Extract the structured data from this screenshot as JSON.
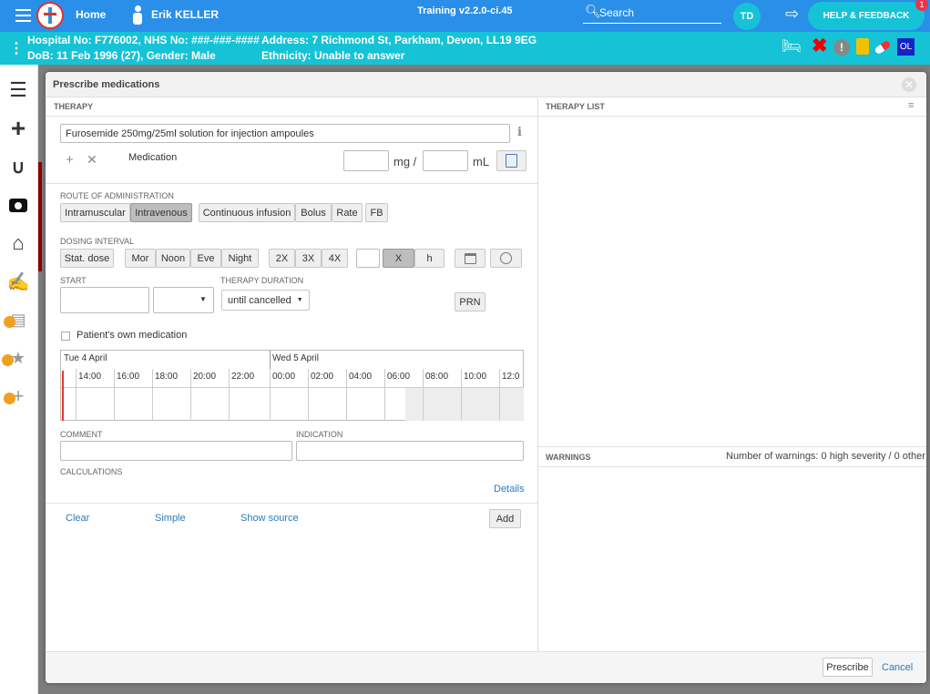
{
  "topbar": {
    "home": "Home",
    "user": "Erik KELLER",
    "version": "Training v2.2.0-ci.45",
    "search": "Search",
    "initials": "TD",
    "help": "HELP & FEEDBACK",
    "help_badge": "1"
  },
  "patient": {
    "line1a": "Hospital No: F776002, NHS No: ###-###-####",
    "line1b": "Address: 7 Richmond St, Parkham, Devon, LL19 9EG",
    "line2a": "DoB: 11 Feb 1996 (27), Gender: Male",
    "line2b": "Ethnicity: Unable to answer",
    "ol": "OL"
  },
  "modal": {
    "title": "Prescribe medications"
  },
  "therapy": {
    "header": "THERAPY",
    "drug": "Furosemide 250mg/25ml solution for injection ampoules",
    "medication_label": "Medication",
    "unit1": "mg /",
    "unit2": "mL"
  },
  "route": {
    "label": "ROUTE OF ADMINISTRATION",
    "buttons": [
      "Intramuscular",
      "Intravenous"
    ],
    "buttons2": [
      "Continuous infusion",
      "Bolus",
      "Rate"
    ],
    "fb": "FB"
  },
  "dosing": {
    "label": "DOSING INTERVAL",
    "stat": "Stat. dose",
    "times": [
      "Mor",
      "Noon",
      "Eve",
      "Night"
    ],
    "freq": [
      "2X",
      "3X",
      "4X"
    ],
    "x": "X",
    "h": "h"
  },
  "start": {
    "label": "START",
    "duration_label": "THERAPY DURATION",
    "duration": "until cancelled",
    "prn": "PRN"
  },
  "own_med": "Patient's own medication",
  "timeline": {
    "day1": "Tue 4 April",
    "day2": "Wed 5 April",
    "hours1": [
      "14:00",
      "16:00",
      "18:00",
      "20:00",
      "22:00"
    ],
    "hours2": [
      "00:00",
      "02:00",
      "04:00",
      "06:00",
      "08:00",
      "10:00",
      "12:0"
    ]
  },
  "comment_label": "COMMENT",
  "indication_label": "INDICATION",
  "calculations_label": "CALCULATIONS",
  "details": "Details",
  "actions": {
    "clear": "Clear",
    "simple": "Simple",
    "show_source": "Show source",
    "add": "Add"
  },
  "therapy_list": {
    "header": "THERAPY LIST"
  },
  "warnings": {
    "header": "WARNINGS",
    "summary": "Number of warnings: 0 high severity / 0 other"
  },
  "footer": {
    "prescribe": "Prescribe",
    "cancel": "Cancel"
  }
}
